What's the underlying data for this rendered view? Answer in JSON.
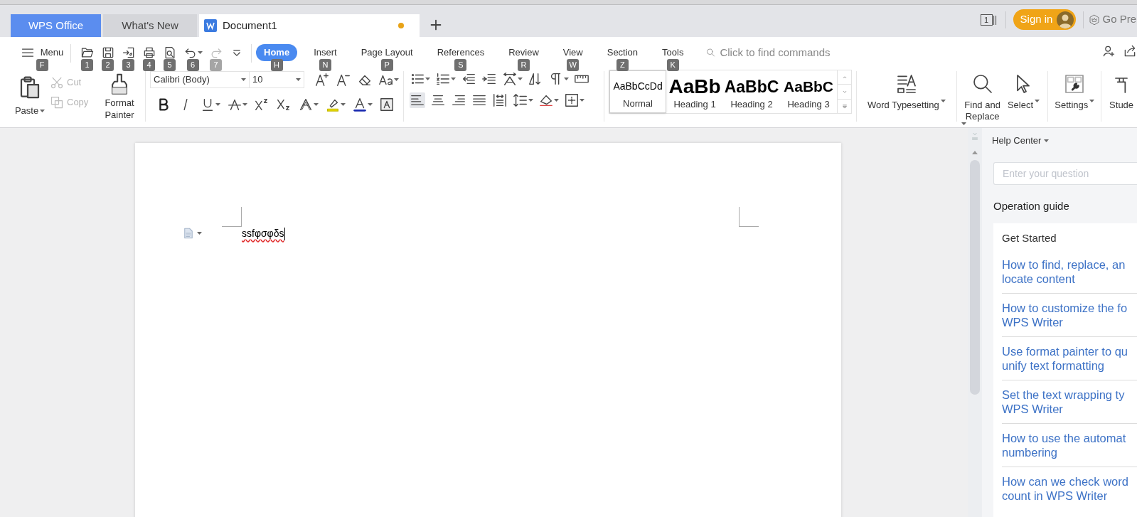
{
  "tabs": [
    {
      "label": "WPS Office",
      "kind": "brand",
      "selected": false,
      "unsaved": false
    },
    {
      "label": "What's New",
      "kind": "page",
      "selected": false,
      "unsaved": false
    },
    {
      "label": "Document1",
      "kind": "document",
      "selected": true,
      "unsaved": true
    }
  ],
  "title_bar": {
    "window_count": "1",
    "sign_in": "Sign in",
    "premium": "Go Pre"
  },
  "menu": {
    "label": "Menu",
    "key": "F"
  },
  "quick_access": [
    {
      "kind": "open",
      "key": "1",
      "disabled": false
    },
    {
      "kind": "save",
      "key": "2",
      "disabled": false
    },
    {
      "kind": "export",
      "key": "3",
      "disabled": false
    },
    {
      "kind": "print",
      "key": "4",
      "disabled": false
    },
    {
      "kind": "preview",
      "key": "5",
      "disabled": false
    },
    {
      "kind": "undo",
      "key": "6",
      "disabled": false
    },
    {
      "kind": "redo",
      "key": "7",
      "disabled": true
    },
    {
      "kind": "more"
    }
  ],
  "ribbon_tabs": [
    {
      "label": "Home",
      "key": "H",
      "selected": true
    },
    {
      "label": "Insert",
      "key": "N",
      "selected": false
    },
    {
      "label": "Page Layout",
      "key": "P",
      "selected": false
    },
    {
      "label": "References",
      "key": "S",
      "selected": false
    },
    {
      "label": "Review",
      "key": "R",
      "selected": false
    },
    {
      "label": "View",
      "key": "W",
      "selected": false
    },
    {
      "label": "Section",
      "key": "Z",
      "selected": false
    },
    {
      "label": "Tools",
      "key": "K",
      "selected": false
    }
  ],
  "command_search": {
    "placeholder": "Click to find commands"
  },
  "clipboard": {
    "paste": "Paste",
    "cut": {
      "label": "Cut",
      "disabled": true
    },
    "copy": {
      "label": "Copy",
      "disabled": true
    },
    "format_painter": "Format Painter"
  },
  "font": {
    "name": "Calibri (Body)",
    "size": "10"
  },
  "styles": [
    {
      "sample": "AaBbCcDd",
      "label": "Normal",
      "kind": "normal",
      "selected": true
    },
    {
      "sample": "AaBb",
      "label": "Heading 1",
      "kind": "h1",
      "selected": false
    },
    {
      "sample": "AaBbC",
      "label": "Heading 2",
      "kind": "h2",
      "selected": false
    },
    {
      "sample": "AaBbC",
      "label": "Heading 3",
      "kind": "h3",
      "selected": false
    }
  ],
  "tools": [
    {
      "kind": "typesetting",
      "label": "Word Typesetting"
    },
    {
      "kind": "find",
      "label": "Find and Replace"
    },
    {
      "kind": "select",
      "label": "Select"
    },
    {
      "kind": "settings",
      "label": "Settings"
    },
    {
      "kind": "student",
      "label": "Stude"
    }
  ],
  "document": {
    "text": "ssfφσφδs"
  },
  "help_panel": {
    "title": "Help Center",
    "search_placeholder": "Enter your question",
    "section": "Operation guide",
    "group": "Get Started",
    "links": [
      {
        "lines": [
          "How to find, replace, an",
          "locate content"
        ]
      },
      {
        "lines": [
          "How to customize the fo",
          "WPS Writer"
        ]
      },
      {
        "lines": [
          "Use format painter to qu",
          "unify text formatting"
        ]
      },
      {
        "lines": [
          "Set the text wrapping ty",
          "WPS Writer"
        ]
      },
      {
        "lines": [
          "How to use the automat",
          "numbering"
        ]
      },
      {
        "lines": [
          "How can we check word",
          "count in WPS Writer"
        ]
      }
    ]
  }
}
